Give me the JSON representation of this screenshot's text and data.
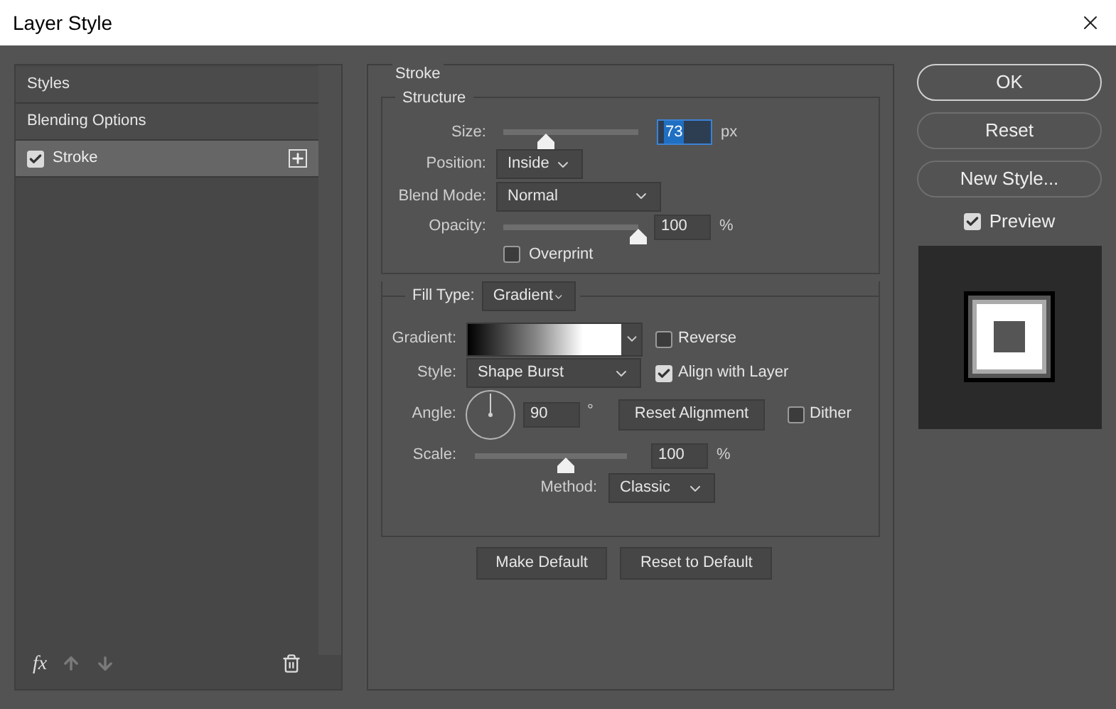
{
  "window": {
    "title": "Layer Style"
  },
  "sidebar": {
    "items": [
      {
        "label": "Styles",
        "kind": "header",
        "selected": false
      },
      {
        "label": "Blending Options",
        "kind": "header",
        "selected": false
      },
      {
        "label": "Stroke",
        "kind": "effect",
        "selected": true,
        "checked": true
      }
    ],
    "fx": "fx"
  },
  "stroke": {
    "title": "Stroke",
    "structure": {
      "title": "Structure",
      "size": {
        "label": "Size:",
        "level": 0.32,
        "value": "73",
        "unit": "px",
        "highlighted": true
      },
      "position": {
        "label": "Position:",
        "value": "Inside"
      },
      "blend_mode": {
        "label": "Blend Mode:",
        "value": "Normal"
      },
      "opacity": {
        "label": "Opacity:",
        "level": 1,
        "value": "100",
        "unit": "%",
        "highlighted": false
      },
      "overprint": {
        "label": "Overprint",
        "checked": false
      }
    },
    "fill": {
      "fill_type": {
        "label": "Fill Type:",
        "value": "Gradient"
      },
      "gradient": {
        "label": "Gradient:"
      },
      "reverse": {
        "label": "Reverse",
        "checked": false
      },
      "style": {
        "label": "Style:",
        "value": "Shape Burst"
      },
      "align": {
        "label": "Align with Layer",
        "checked": true
      },
      "angle": {
        "label": "Angle:",
        "value": "90",
        "unit": "°"
      },
      "reset_alignment": "Reset Alignment",
      "dither": {
        "label": "Dither",
        "checked": false
      },
      "scale": {
        "label": "Scale:",
        "level": 0.6,
        "value": "100",
        "unit": "%",
        "highlighted": false
      },
      "method": {
        "label": "Method:",
        "value": "Classic"
      }
    },
    "buttons": [
      "Make Default",
      "Reset to Default"
    ]
  },
  "actions": {
    "buttons": [
      {
        "label": "OK",
        "kind": "default"
      },
      {
        "label": "Reset",
        "kind": "normal"
      },
      {
        "label": "New Style...",
        "kind": "normal"
      }
    ],
    "preview": {
      "label": "Preview",
      "checked": true
    }
  }
}
